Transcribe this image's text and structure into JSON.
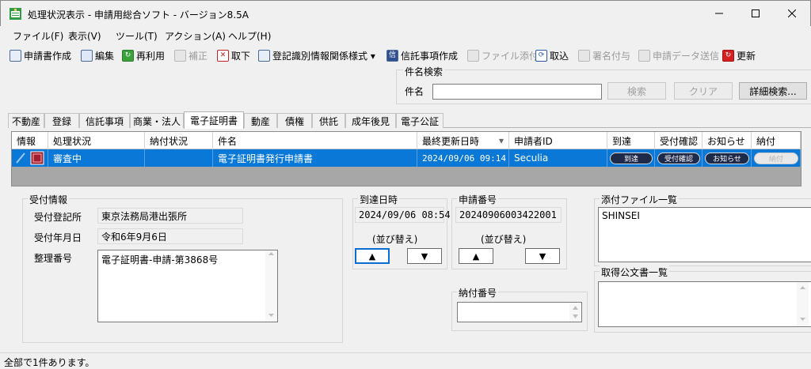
{
  "window": {
    "title": "処理状況表示 - 申請用総合ソフト - バージョン8.5A"
  },
  "menu": [
    {
      "label": "ファイル(F)"
    },
    {
      "label": "表示(V)"
    },
    {
      "label": "ツール(T)"
    },
    {
      "label": "アクション(A)"
    },
    {
      "label": "ヘルプ(H)"
    }
  ],
  "toolbar": [
    {
      "label": "申請書作成",
      "icon": "create-application-icon",
      "enabled": true
    },
    {
      "label": "編集",
      "icon": "edit-icon",
      "enabled": true
    },
    {
      "label": "再利用",
      "icon": "reuse-icon",
      "enabled": true
    },
    {
      "label": "補正",
      "icon": "correction-icon",
      "enabled": false
    },
    {
      "label": "取下",
      "icon": "withdraw-icon",
      "enabled": true
    },
    {
      "label": "登記識別情報関係様式 ▾",
      "icon": "registration-forms-icon",
      "enabled": true
    },
    {
      "label": "信託事項作成",
      "icon": "trust-create-icon",
      "enabled": true
    },
    {
      "label": "ファイル添付",
      "icon": "attach-file-icon",
      "enabled": false
    },
    {
      "label": "取込",
      "icon": "import-icon",
      "enabled": true
    },
    {
      "label": "署名付与",
      "icon": "sign-icon",
      "enabled": false
    },
    {
      "label": "申請データ送信",
      "icon": "send-icon",
      "enabled": false
    },
    {
      "label": "更新",
      "icon": "refresh-icon",
      "enabled": true
    }
  ],
  "search": {
    "group_label": "件名検索",
    "field_label": "件名",
    "value": "",
    "search_button": "検索",
    "clear_button": "クリア",
    "detail_button": "詳細検索..."
  },
  "tabs": [
    {
      "label": "不動産"
    },
    {
      "label": "登録"
    },
    {
      "label": "信託事項"
    },
    {
      "label": "商業・法人"
    },
    {
      "label": "電子証明書",
      "active": true
    },
    {
      "label": "動産"
    },
    {
      "label": "債権"
    },
    {
      "label": "供託"
    },
    {
      "label": "成年後見"
    },
    {
      "label": "電子公証"
    }
  ],
  "table": {
    "columns": [
      "情報",
      "処理状況",
      "納付状況",
      "件名",
      "最終更新日時",
      "申請者ID",
      "到達",
      "受付確認",
      "お知らせ",
      "納付"
    ],
    "sort_indicator": "▾",
    "rows": [
      {
        "status": "審査中",
        "payment_status": "",
        "subject": "電子証明書発行申請書",
        "updated": "2024/09/06 09:14",
        "applicant_id": "Seculia",
        "arrival": "到達",
        "receipt": "受付確認",
        "notice": "お知らせ",
        "payment": "納付"
      }
    ]
  },
  "receipt_info": {
    "group_label": "受付情報",
    "office_label": "受付登記所",
    "office_value": "東京法務局港出張所",
    "date_label": "受付年月日",
    "date_value": "令和6年9月6日",
    "ref_label": "整理番号",
    "ref_value": "電子証明書-申請-第3868号"
  },
  "arrival_time": {
    "group_label": "到達日時",
    "value": "2024/09/06 08:54",
    "sort_label": "(並び替え)",
    "up_glyph": "▲",
    "down_glyph": "▼"
  },
  "application_number": {
    "group_label": "申請番号",
    "value": "20240906003422001",
    "sort_label": "(並び替え)",
    "up_glyph": "▲",
    "down_glyph": "▼"
  },
  "payment_number": {
    "group_label": "納付番号",
    "value": ""
  },
  "attachments": {
    "group_label": "添付ファイル一覧",
    "items": [
      "SHINSEI"
    ]
  },
  "official_docs": {
    "group_label": "取得公文書一覧",
    "items": []
  },
  "status": {
    "text": "全部で1件あります。"
  },
  "colors": {
    "selection": "#0a78d7",
    "panel": "#f0f0f0",
    "grid_empty": "#a7a7a7"
  }
}
